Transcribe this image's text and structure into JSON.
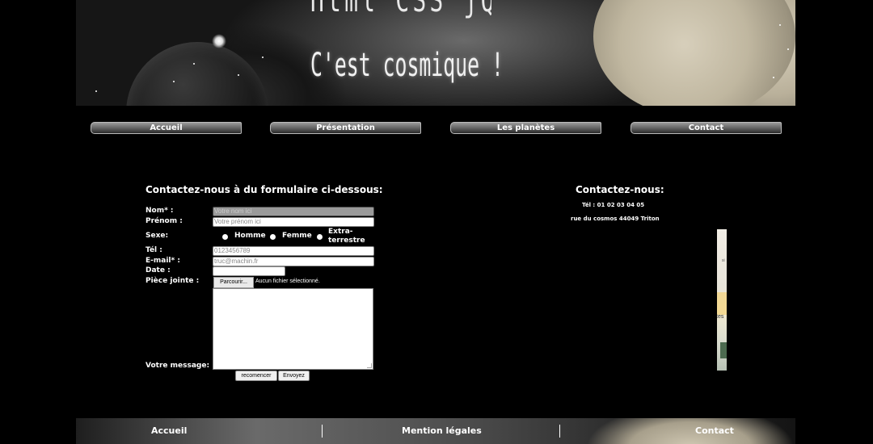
{
  "banner": {
    "line1": "Html CSS jQuery",
    "line2": "C'est cosmique !"
  },
  "nav": {
    "items": [
      {
        "label": "Accueil"
      },
      {
        "label": "Présentation"
      },
      {
        "label": "Les planètes"
      },
      {
        "label": "Contact"
      }
    ]
  },
  "form": {
    "title": "Contactez-nous à du formulaire ci-dessous:",
    "nom_label": "Nom* :",
    "nom_placeholder": "Votre nom ici",
    "prenom_label": "Prénom :",
    "prenom_placeholder": "Votre prénom ici",
    "sexe_label": "Sexe:",
    "sexe_options": [
      "Homme",
      "Femme",
      "Extra-terrestre"
    ],
    "tel_label": "Tél :",
    "tel_placeholder": "0123456789",
    "email_label": "E-mail* :",
    "email_placeholder": "truc@machin.fr",
    "date_label": "Date :",
    "piece_label": "Pièce jointe :",
    "file_button": "Parcourir...",
    "file_note": "Aucun fichier sélectionné.",
    "message_label": "Votre message:",
    "reset_button": "recomencer",
    "submit_button": "Envoyez"
  },
  "contact": {
    "title": "Contactez-nous:",
    "tel": "Tél : 01 02 03 04 05",
    "address": "rue du cosmos 44049 Triton",
    "map_text": "tes",
    "map_text_small": "si"
  },
  "footer": {
    "links": [
      {
        "label": "Accueil"
      },
      {
        "label": "Mention légales"
      },
      {
        "label": "Contact"
      }
    ]
  }
}
